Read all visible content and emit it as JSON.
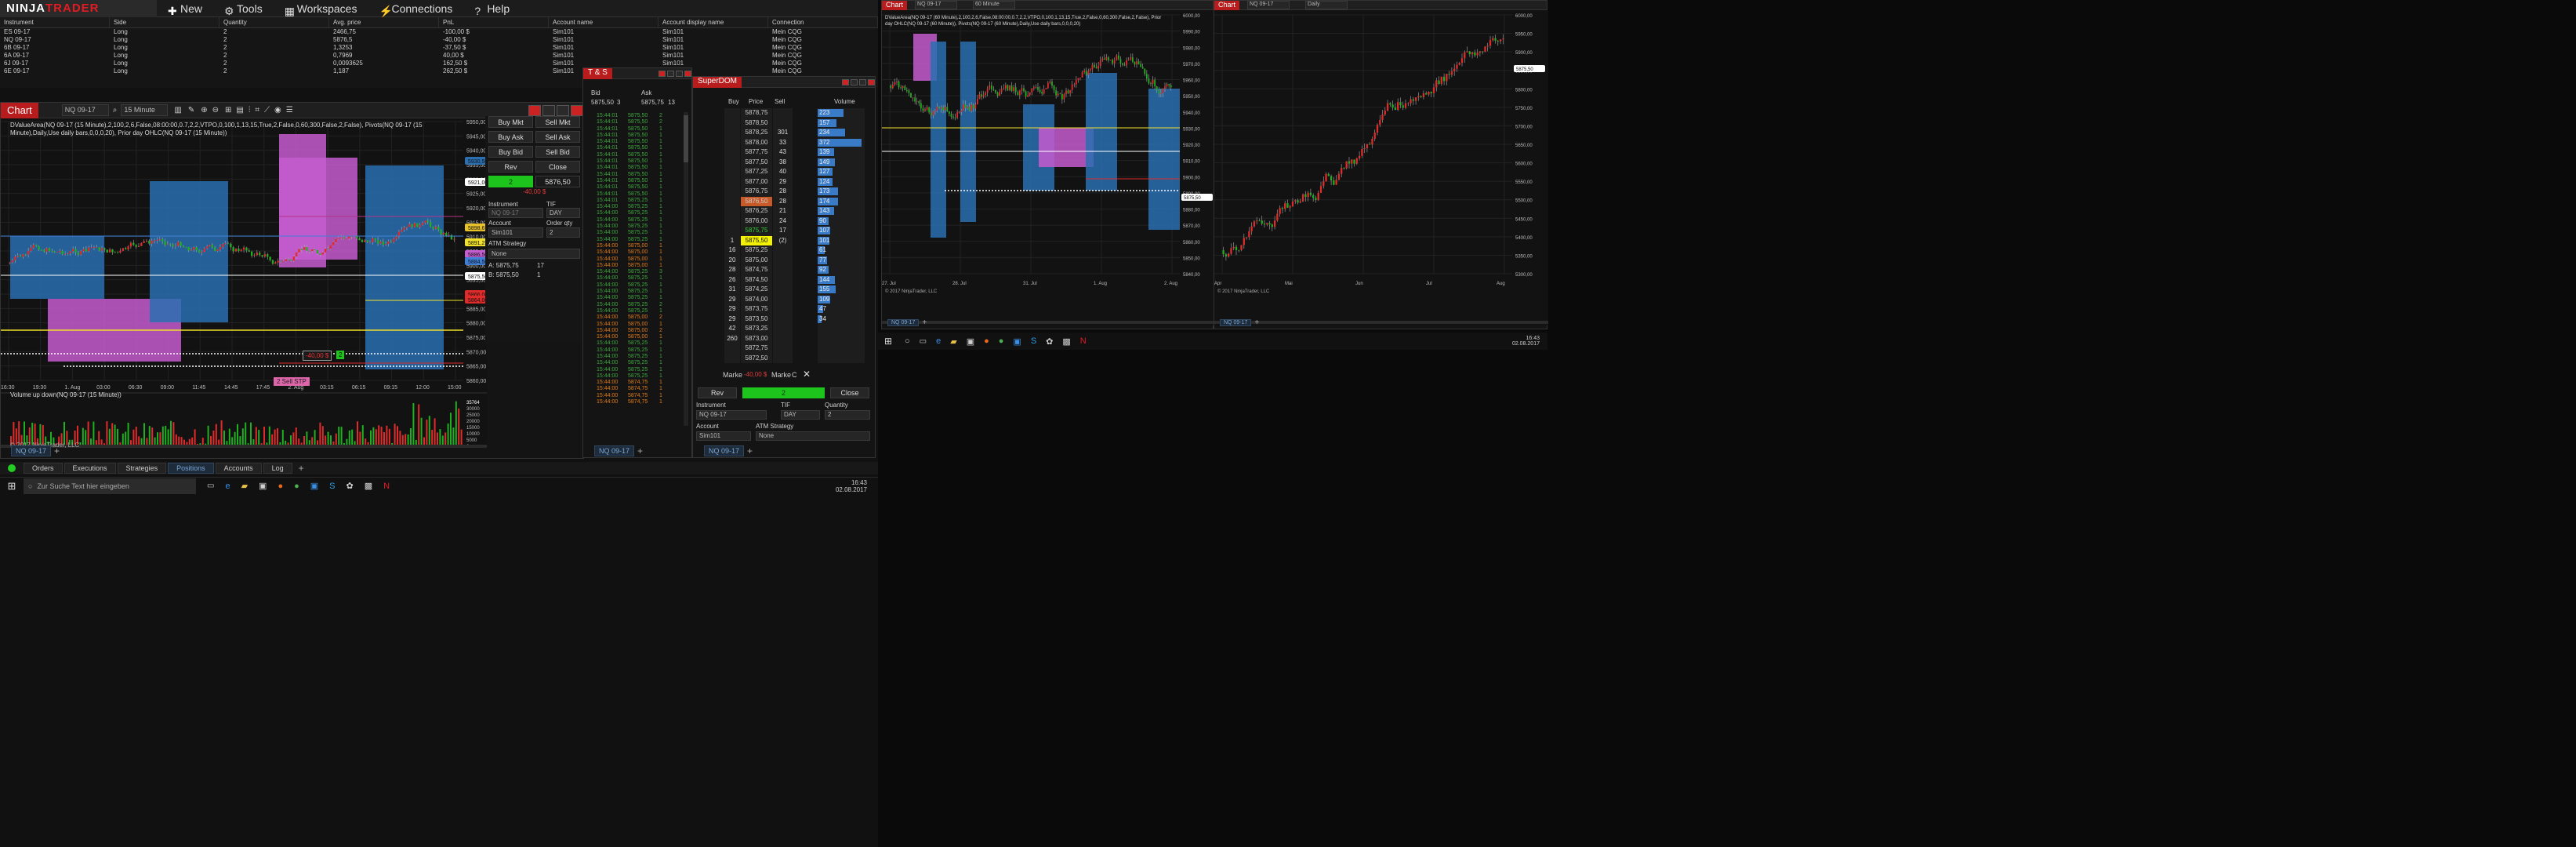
{
  "app": {
    "logo": "NINJATRADER"
  },
  "menu": [
    "New",
    "Tools",
    "Workspaces",
    "Connections",
    "Help"
  ],
  "positions": {
    "headers": [
      "Instrument",
      "Side",
      "Quantity",
      "Avg. price",
      "PnL",
      "Account name",
      "Account display name",
      "Connection"
    ],
    "rows": [
      [
        "ES 09-17",
        "Long",
        "2",
        "2466,75",
        "-100,00 $",
        "Sim101",
        "Sim101",
        "Mein CQG"
      ],
      [
        "NQ 09-17",
        "Long",
        "2",
        "5876,5",
        "-40,00 $",
        "Sim101",
        "Sim101",
        "Mein CQG"
      ],
      [
        "6B 09-17",
        "Long",
        "2",
        "1,3253",
        "-37,50 $",
        "Sim101",
        "Sim101",
        "Mein CQG"
      ],
      [
        "6A 09-17",
        "Long",
        "2",
        "0,7969",
        "40,00 $",
        "Sim101",
        "Sim101",
        "Mein CQG"
      ],
      [
        "6J 09-17",
        "Long",
        "2",
        "0,0093625",
        "162,50 $",
        "Sim101",
        "Sim101",
        "Mein CQG"
      ],
      [
        "6E 09-17",
        "Long",
        "2",
        "1,187",
        "262,50 $",
        "Sim101",
        "Sim101",
        "Mein CQG"
      ]
    ]
  },
  "chart1": {
    "title": "Chart",
    "instrument": "NQ 09-17",
    "interval": "15 Minute",
    "indicator_line": "DValueArea(NQ 09-17 (15 Minute),2,100,2,6,False,08:00:00,0.7,2,2,VTPO,0,100,1,13,15,True,2,False,0,60,300,False,2,False), Pivots(NQ 09-17 (15 Minute),Daily,Use daily bars,0,0,0,20), Prior day OHLC(NQ 09-17 (15 Minute))",
    "copyright": "© 2017 NinjaTrader, LLC",
    "volume_label": "Volume up down(NQ 09-17 (15 Minute))",
    "y_ticks": [
      "5950,00",
      "5945,00",
      "5940,00",
      "5935,00",
      "5930,00",
      "5925,00",
      "5920,00",
      "5915,00",
      "5910,00",
      "5905,00",
      "5900,00",
      "5895,00",
      "5890,00",
      "5885,00",
      "5880,00",
      "5875,00",
      "5870,00",
      "5865,00",
      "5860,00"
    ],
    "price_tags": [
      "5930,50",
      "5921,00",
      "5898,67",
      "5891,25",
      "5886,50",
      "5884,50",
      "5875,50",
      "5866,00",
      "5864,00"
    ],
    "vol_ticks": [
      "35764",
      "30000",
      "25000",
      "20000",
      "15000",
      "10000",
      "5000",
      "0"
    ],
    "x_ticks": [
      "16:30",
      "19:30",
      "1. Aug",
      "03:00",
      "06:30",
      "09:00",
      "11:45",
      "14:45",
      "17:45",
      "2. Aug",
      "03:15",
      "06:15",
      "09:15",
      "12:00",
      "15:00"
    ],
    "order_marker": "-40,00 $",
    "order_qty": "2",
    "stop_label": "2  Sell STP",
    "tab": "NQ 09-17"
  },
  "chart_trader": {
    "buy_mkt": "Buy Mkt",
    "sell_mkt": "Sell Mkt",
    "buy_ask": "Buy Ask",
    "sell_ask": "Sell Ask",
    "buy_bid": "Buy Bid",
    "sell_bid": "Sell Bid",
    "rev": "Rev",
    "close": "Close",
    "position_qty": "2",
    "position_price": "5876,50",
    "pnl": "-40,00 $",
    "instrument_label": "Instrument",
    "instrument": "NQ 09-17",
    "tif_label": "TIF",
    "tif": "DAY",
    "account_label": "Account",
    "account": "Sim101",
    "order_qty_label": "Order qty",
    "order_qty": "2",
    "atm_label": "ATM Strategy",
    "atm": "None",
    "ask_line": "A:  5875,75",
    "ask_size": "17",
    "bid_line": "B:  5875,50",
    "bid_size": "1"
  },
  "ts": {
    "title": "T & S",
    "bid_label": "Bid",
    "ask_label": "Ask",
    "bid": "5875,50",
    "bid_size": "3",
    "ask": "5875,75",
    "ask_size": "13",
    "tab": "NQ 09-17",
    "rows": [
      [
        "15:44:01",
        "5875,50",
        "2",
        "g"
      ],
      [
        "15:44:01",
        "5875,50",
        "2",
        "g"
      ],
      [
        "15:44:01",
        "5875,50",
        "1",
        "g"
      ],
      [
        "15:44:01",
        "5875,50",
        "1",
        "g"
      ],
      [
        "15:44:01",
        "5875,50",
        "1",
        "g"
      ],
      [
        "15:44:01",
        "5875,50",
        "1",
        "g"
      ],
      [
        "15:44:01",
        "5875,50",
        "1",
        "g"
      ],
      [
        "15:44:01",
        "5875,50",
        "1",
        "g"
      ],
      [
        "15:44:01",
        "5875,50",
        "1",
        "g"
      ],
      [
        "15:44:01",
        "5875,50",
        "1",
        "g"
      ],
      [
        "15:44:01",
        "5875,50",
        "1",
        "g"
      ],
      [
        "15:44:01",
        "5875,50",
        "1",
        "g"
      ],
      [
        "15:44:01",
        "5875,50",
        "1",
        "g"
      ],
      [
        "15:44:01",
        "5875,25",
        "1",
        "g"
      ],
      [
        "15:44:00",
        "5875,25",
        "1",
        "g"
      ],
      [
        "15:44:00",
        "5875,25",
        "1",
        "g"
      ],
      [
        "15:44:00",
        "5875,25",
        "1",
        "g"
      ],
      [
        "15:44:00",
        "5875,25",
        "1",
        "g"
      ],
      [
        "15:44:00",
        "5875,25",
        "1",
        "g"
      ],
      [
        "15:44:00",
        "5875,25",
        "1",
        "g"
      ],
      [
        "15:44:00",
        "5875,00",
        "1",
        "r"
      ],
      [
        "15:44:00",
        "5875,00",
        "1",
        "r"
      ],
      [
        "15:44:00",
        "5875,00",
        "1",
        "r"
      ],
      [
        "15:44:00",
        "5875,00",
        "1",
        "r"
      ],
      [
        "15:44:00",
        "5875,25",
        "3",
        "g"
      ],
      [
        "15:44:00",
        "5875,25",
        "1",
        "g"
      ],
      [
        "15:44:00",
        "5875,25",
        "1",
        "g"
      ],
      [
        "15:44:00",
        "5875,25",
        "1",
        "g"
      ],
      [
        "15:44:00",
        "5875,25",
        "1",
        "g"
      ],
      [
        "15:44:00",
        "5875,25",
        "2",
        "g"
      ],
      [
        "15:44:00",
        "5875,25",
        "1",
        "g"
      ],
      [
        "15:44:00",
        "5875,00",
        "2",
        "r"
      ],
      [
        "15:44:00",
        "5875,00",
        "1",
        "r"
      ],
      [
        "15:44:00",
        "5875,00",
        "2",
        "r"
      ],
      [
        "15:44:00",
        "5875,00",
        "1",
        "r"
      ],
      [
        "15:44:00",
        "5875,25",
        "1",
        "g"
      ],
      [
        "15:44:00",
        "5875,25",
        "1",
        "g"
      ],
      [
        "15:44:00",
        "5875,25",
        "1",
        "g"
      ],
      [
        "15:44:00",
        "5875,25",
        "1",
        "g"
      ],
      [
        "15:44:00",
        "5875,25",
        "1",
        "g"
      ],
      [
        "15:44:00",
        "5875,25",
        "1",
        "g"
      ],
      [
        "15:44:00",
        "5874,75",
        "1",
        "r"
      ],
      [
        "15:44:00",
        "5874,75",
        "1",
        "r"
      ],
      [
        "15:44:00",
        "5874,75",
        "1",
        "r"
      ],
      [
        "15:44:00",
        "5874,75",
        "1",
        "r"
      ]
    ]
  },
  "dom": {
    "title": "SuperDOM",
    "col_buy": "Buy",
    "col_price": "Price",
    "col_sell": "Sell",
    "col_volume": "Volume",
    "rows": [
      [
        "",
        "5878,75",
        "",
        "223"
      ],
      [
        "",
        "5878,50",
        "",
        "157"
      ],
      [
        "",
        "5878,25",
        "301",
        "234"
      ],
      [
        "",
        "5878,00",
        "33",
        "372"
      ],
      [
        "",
        "5877,75",
        "43",
        "139"
      ],
      [
        "",
        "5877,50",
        "38",
        "149"
      ],
      [
        "",
        "5877,25",
        "40",
        "127"
      ],
      [
        "",
        "5877,00",
        "29",
        "124"
      ],
      [
        "",
        "5876,75",
        "28",
        "173"
      ],
      [
        "",
        "5876,50",
        "28",
        "174"
      ],
      [
        "",
        "5876,25",
        "21",
        "143"
      ],
      [
        "",
        "5876,00",
        "24",
        "90"
      ],
      [
        "",
        "5875,75",
        "17",
        "107"
      ],
      [
        "1",
        "5875,50",
        "(2)",
        "101"
      ],
      [
        "16",
        "5875,25",
        "",
        "61"
      ],
      [
        "20",
        "5875,00",
        "",
        "77"
      ],
      [
        "28",
        "5874,75",
        "",
        "92"
      ],
      [
        "26",
        "5874,50",
        "",
        "144"
      ],
      [
        "31",
        "5874,25",
        "",
        "155"
      ],
      [
        "29",
        "5874,00",
        "",
        "109"
      ],
      [
        "29",
        "5873,75",
        "",
        "47"
      ],
      [
        "29",
        "5873,50",
        "",
        "34"
      ],
      [
        "42",
        "5873,25",
        "",
        " "
      ],
      [
        "260",
        "5873,00",
        "",
        " "
      ],
      [
        "",
        "5872,75",
        "",
        " "
      ],
      [
        "",
        "5872,50",
        "",
        " "
      ]
    ],
    "market_left": "Marke",
    "pnl": "-40,00 $",
    "market_right": "Marke",
    "c_label": "C",
    "rev": "Rev",
    "qty": "2",
    "close": "Close",
    "instrument_label": "Instrument",
    "instrument": "NQ 09-17",
    "tif_label": "TIF",
    "tif": "DAY",
    "quantity_label": "Quantity",
    "quantity": "2",
    "account_label": "Account",
    "account": "Sim101",
    "atm_label": "ATM Strategy",
    "atm": "None",
    "tab": "NQ 09-17"
  },
  "bottom_tabs": [
    "Orders",
    "Executions",
    "Strategies",
    "Positions",
    "Accounts",
    "Log"
  ],
  "taskbar": {
    "search": "Zur Suche Text hier eingeben",
    "time": "16:43",
    "date": "02.08.2017"
  },
  "chart2": {
    "title": "Chart",
    "instrument": "NQ 09-17",
    "interval": "60 Minute",
    "indicator_line": "DValueArea(NQ 09-17 (60 Minute),2,100,2,6,False,08:00:00,0.7,2,2,VTPO,0,100,1,13,15,True,2,False,0,60,300,False,2,False), Prior day OHLC(NQ 09-17 (60 Minute)), Pivots(NQ 09-17 (60 Minute),Daily,Use daily bars,0,0,0,20)",
    "y_ticks": [
      "6000,00",
      "5990,00",
      "5980,00",
      "5970,00",
      "5960,00",
      "5950,00",
      "5940,00",
      "5930,00",
      "5920,00",
      "5910,00",
      "5900,00",
      "5890,00",
      "5880,00",
      "5870,00",
      "5860,00",
      "5850,00",
      "5840,00"
    ],
    "x_ticks": [
      "27. Jul",
      "28. Jul",
      "31. Jul",
      "1. Aug",
      "2. Aug"
    ],
    "last": "5875,50",
    "copyright": "© 2017 NinjaTrader, LLC",
    "tab": "NQ 09-17"
  },
  "chart3": {
    "title": "Chart",
    "instrument": "NQ 09-17",
    "interval": "Daily",
    "y_ticks": [
      "6000,00",
      "5950,00",
      "5900,00",
      "5850,00",
      "5800,00",
      "5750,00",
      "5700,00",
      "5650,00",
      "5600,00",
      "5550,00",
      "5500,00",
      "5450,00",
      "5400,00",
      "5350,00",
      "5300,00"
    ],
    "x_ticks": [
      "Apr",
      "Mai",
      "Jun",
      "Jul",
      "Aug"
    ],
    "last": "5875,50",
    "copyright": "© 2017 NinjaTrader, LLC",
    "tab": "NQ 09-17"
  },
  "taskbar2": {
    "time": "16:43",
    "date": "02.08.2017"
  }
}
